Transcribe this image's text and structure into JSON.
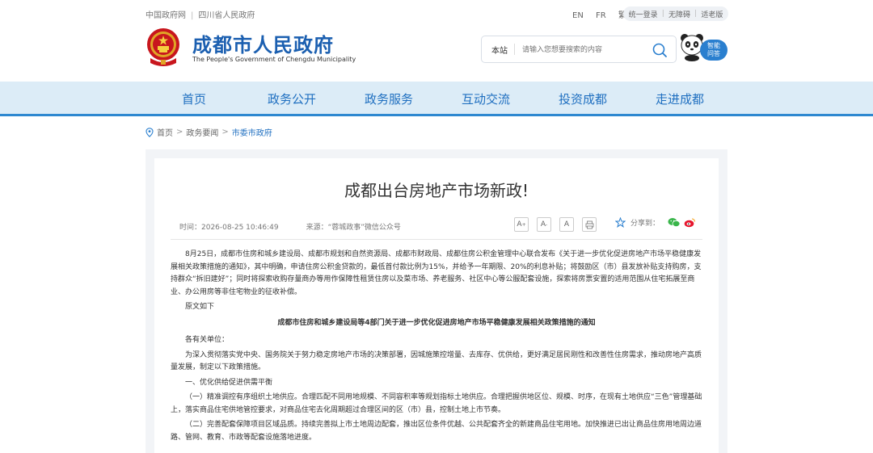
{
  "topbar": {
    "gov_link": "中国政府网",
    "prov_link": "四川省人民政府",
    "lang_en": "EN",
    "lang_fr": "FR",
    "lang_tc": "繁",
    "login": "统一登录",
    "barrier_free": "无障碍",
    "elder": "适老版"
  },
  "header": {
    "title": "成都市人民政府",
    "subtitle": "The People's  Government of Chengdu Municipality"
  },
  "search": {
    "scope": "本站",
    "placeholder": "请输入您想要搜索的内容"
  },
  "assistant": {
    "line1": "智能",
    "line2": "问答"
  },
  "nav": {
    "items": [
      "首页",
      "政务公开",
      "政务服务",
      "互动交流",
      "投资成都",
      "走进成都"
    ]
  },
  "breadcrumb": {
    "home": "首页",
    "level2": "政务要闻",
    "current": "市委市政府"
  },
  "article": {
    "title": "成都出台房地产市场新政!",
    "time": "时间：2026-08-25 10:46:49",
    "source": "来源：“蓉城政事”微信公众号",
    "font_large": "A",
    "font_medium": "A",
    "font_small": "A",
    "share_label": "分享到：",
    "paragraphs": [
      "8月25日，成都市住房和城乡建设局、成都市规划和自然资源局、成都市财政局、成都住房公积金管理中心联合发布《关于进一步优化促进房地产市场平稳健康发展相关政策措施的通知》，其中明确，申请住房公积金贷款的，最低首付款比例为15%，并给予一年期限、20%的利息补贴；将鼓励区（市）县发放补贴支持购房，支持群众“拆旧建好”；同时将探索收购存量商办等用作保障性租赁住房以及菜市场、养老服务、社区中心等公服配套设施，探索将房票安置的适用范围从住宅拓展至商业、办公用房等非住宅物业的征收补偿。",
      "原文如下"
    ],
    "doc_title": "成都市住房和城乡建设局等4部门关于进一步优化促进房地产市场平稳健康发展相关政策措施的通知",
    "paragraphs2": [
      "各有关单位：",
      "为深入贯彻落实党中央、国务院关于努力稳定房地产市场的决策部署，因城施策控增量、去库存、优供给，更好满足居民刚性和改善性住房需求，推动房地产高质量发展，制定以下政策措施。",
      "一、优化供给促进供需平衡",
      "（一）精准调控有序组织土地供应。合理匹配不同用地规模、不同容积率等规划指标土地供应。合理把握供地区位、规模、时序，在现有土地供应“三色”管理基础上，落实商品住宅供地管控要求，对商品住宅去化周期超过合理区间的区（市）县，控制土地上市节奏。",
      "（二）完善配套保障项目区域品质。持续完善拟上市土地周边配套，推出区位条件优越、公共配套齐全的新建商品住宅用地。加快推进已出让商品住房用地周边道路、管网、教育、市政等配套设施落地进度。"
    ]
  },
  "colors": {
    "brand_blue": "#1b5fb0",
    "nav_bg": "#dcecf7",
    "nav_text": "#1f6fc0",
    "nav_border": "#2e88d0"
  }
}
